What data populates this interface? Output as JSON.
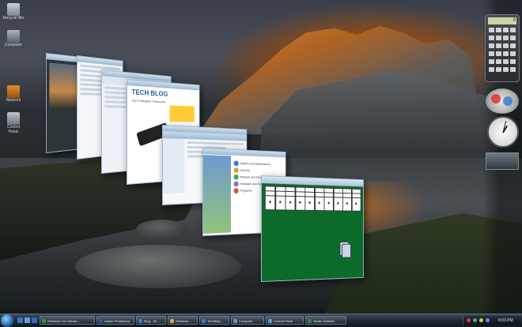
{
  "screen": {
    "title": "Windows Vista Flip 3D desktop"
  },
  "desktop_icons": [
    {
      "label": "Recycle Bin",
      "icon": "recycle-bin-icon"
    },
    {
      "label": "Computer",
      "icon": "computer-icon"
    },
    {
      "label": "Network",
      "icon": "network-icon"
    },
    {
      "label": "Control Panel",
      "icon": "control-panel-icon"
    }
  ],
  "windows": {
    "blog_title": "TECH BLOG",
    "blog_post": "Top 5 Stargazer Telescopes",
    "cp_items": [
      "System and Maintenance",
      "Security",
      "Network and Internet",
      "Hardware and Sound",
      "Programs"
    ]
  },
  "gadgets": {
    "calc_display": "0"
  },
  "taskbar": {
    "buttons": [
      {
        "label": "Windows Live Messe...",
        "icon": "messenger-icon",
        "color": "#2f8f3d"
      },
      {
        "label": "Adobe Photoshop",
        "icon": "photoshop-icon",
        "color": "#2a5aa8"
      },
      {
        "label": "Blog - Wi...",
        "icon": "browser-icon",
        "color": "#3d79c8"
      },
      {
        "label": "Windows ...",
        "icon": "explorer-icon",
        "color": "#d8a83a"
      },
      {
        "label": "TechBlog ...",
        "icon": "browser-icon",
        "color": "#3d79c8"
      },
      {
        "label": "Computer",
        "icon": "computer-icon",
        "color": "#6c94c0"
      },
      {
        "label": "Control Panel",
        "icon": "control-panel-icon",
        "color": "#5a9bd0"
      },
      {
        "label": "Spider Solitaire",
        "icon": "solitaire-icon",
        "color": "#2d8b3a"
      }
    ],
    "time": "8:03 PM"
  }
}
